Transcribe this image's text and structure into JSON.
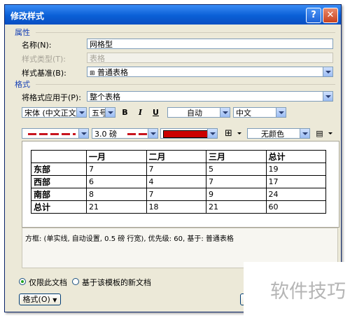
{
  "dialog": {
    "title": "修改样式",
    "help_label": "?",
    "close_label": "✕"
  },
  "properties": {
    "section_label": "属性",
    "name_label": "名称(N):",
    "name_value": "网格型",
    "style_type_label": "样式类型(T):",
    "style_type_value": "表格",
    "based_on_label": "样式基准(B):",
    "based_on_value": "普通表格"
  },
  "format": {
    "section_label": "格式",
    "apply_to_label": "将格式应用于(P):",
    "apply_to_value": "整个表格",
    "font_value": "宋体 (中文正文)",
    "size_value": "五号",
    "bold_label": "B",
    "italic_label": "I",
    "underline_label": "U",
    "font_color_value": "自动",
    "script_value": "中文",
    "line_weight_value": "3.0 磅",
    "border_color": "#cc0000",
    "shading_value": "无颜色"
  },
  "preview": {
    "rows": [
      [
        "",
        "一月",
        "二月",
        "三月",
        "总计"
      ],
      [
        "东部",
        "7",
        "7",
        "5",
        "19"
      ],
      [
        "西部",
        "6",
        "4",
        "7",
        "17"
      ],
      [
        "南部",
        "8",
        "7",
        "9",
        "24"
      ],
      [
        "总计",
        "21",
        "18",
        "21",
        "60"
      ]
    ]
  },
  "description": "方框: (单实线, 自动设置, 0.5 磅 行宽), 优先级: 60, 基于: 普通表格",
  "scope": {
    "this_document_label": "仅限此文档",
    "template_label": "基于该模板的新文档",
    "selected": "this_document"
  },
  "footer": {
    "format_button_label": "格式(O)"
  },
  "watermark": {
    "text": "软件技巧"
  }
}
